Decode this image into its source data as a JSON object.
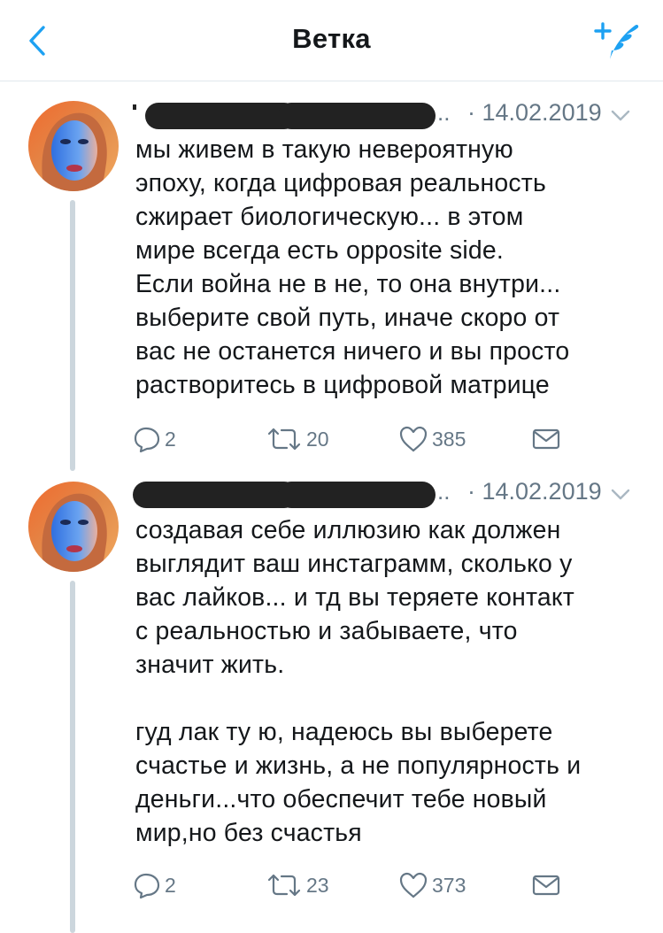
{
  "header": {
    "title": "Ветка",
    "back_icon": "chevron-left-icon",
    "compose_icon": "compose-tweet-icon",
    "accent_color": "#1da1f2"
  },
  "tweets": [
    {
      "dots": "..",
      "date": "· 14.02.2019",
      "text": "мы живем в такую невероятную\nэпоху, когда цифровая реальность\nсжирает биологическую... в этом\nмире всегда есть opposite side.\nЕсли война не в не, то она внутри...\nвыберите свой путь, иначе скоро от\nвас не останется ничего и вы просто\nрастворитесь в цифровой матрице",
      "replies": "2",
      "retweets": "20",
      "likes": "385"
    },
    {
      "dots": "..",
      "date": "· 14.02.2019",
      "text": "создавая себе иллюзию как должен\nвыглядит ваш инстаграмм, сколько у\nвас лайков... и тд вы теряете контакт\nс реальностью и забываете, что\nзначит жить.\n\nгуд лак ту ю, надеюсь вы выберете\nсчастье и жизнь, а не популярность и\nденьги...что обеспечит тебе новый\nмир,но без счастья",
      "replies": "2",
      "retweets": "23",
      "likes": "373"
    }
  ]
}
